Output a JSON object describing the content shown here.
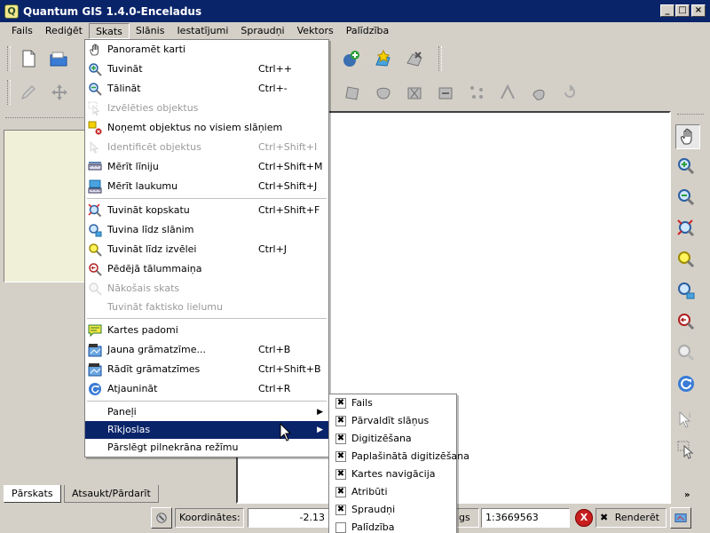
{
  "window": {
    "title": "Quantum GIS 1.4.0-Enceladus",
    "logo_letter": "Q",
    "min_glyph": "_",
    "max_glyph": "□",
    "close_glyph": "×"
  },
  "menubar": [
    "Fails",
    "Rediģēt",
    "Skats",
    "Slānis",
    "Iestatījumi",
    "Spraudņi",
    "Vektors",
    "Palīdzība"
  ],
  "view_menu": [
    {
      "label": "Panoramēt karti",
      "shortcut": "",
      "disabled": false,
      "icon": "pan-hand-icon"
    },
    {
      "label": "Tuvināt",
      "shortcut": "Ctrl++",
      "disabled": false,
      "icon": "zoom-in-icon"
    },
    {
      "label": "Tālināt",
      "shortcut": "Ctrl+-",
      "disabled": false,
      "icon": "zoom-out-icon"
    },
    {
      "label": "Izvēlēties objektus",
      "shortcut": "",
      "disabled": true,
      "icon": "select-features-icon"
    },
    {
      "label": "Noņemt objektus no visiem slāņiem",
      "shortcut": "",
      "disabled": false,
      "icon": "deselect-icon"
    },
    {
      "label": "Identificēt objektus",
      "shortcut": "Ctrl+Shift+I",
      "disabled": true,
      "icon": "identify-icon"
    },
    {
      "label": "Mērīt līniju",
      "shortcut": "Ctrl+Shift+M",
      "disabled": false,
      "icon": "measure-line-icon"
    },
    {
      "label": "Mērīt laukumu",
      "shortcut": "Ctrl+Shift+J",
      "disabled": false,
      "icon": "measure-area-icon"
    },
    {
      "sep": true
    },
    {
      "label": "Tuvināt kopskatu",
      "shortcut": "Ctrl+Shift+F",
      "disabled": false,
      "icon": "zoom-full-icon"
    },
    {
      "label": "Tuvina līdz slānim",
      "shortcut": "",
      "disabled": false,
      "icon": "zoom-layer-icon"
    },
    {
      "label": "Tuvināt līdz izvēlei",
      "shortcut": "Ctrl+J",
      "disabled": false,
      "icon": "zoom-selection-icon"
    },
    {
      "label": "Pēdējā tālummaiņa",
      "shortcut": "",
      "disabled": false,
      "icon": "zoom-last-icon"
    },
    {
      "label": "Nākošais skats",
      "shortcut": "",
      "disabled": true,
      "icon": "zoom-next-icon"
    },
    {
      "label": "Tuvināt faktisko lielumu",
      "shortcut": "",
      "disabled": true,
      "icon": ""
    },
    {
      "sep": true
    },
    {
      "label": "Kartes padomi",
      "shortcut": "",
      "disabled": false,
      "icon": "map-tips-icon"
    },
    {
      "label": "Jauna grāmatzīme...",
      "shortcut": "Ctrl+B",
      "disabled": false,
      "icon": "new-bookmark-icon"
    },
    {
      "label": "Rādīt grāmatzīmes",
      "shortcut": "Ctrl+Shift+B",
      "disabled": false,
      "icon": "show-bookmarks-icon"
    },
    {
      "label": "Atjaunināt",
      "shortcut": "Ctrl+R",
      "disabled": false,
      "icon": "refresh-icon"
    },
    {
      "sep": true
    },
    {
      "label": "Paneļi",
      "shortcut": "",
      "disabled": false,
      "submenu": true
    },
    {
      "label": "Rīkjoslas",
      "shortcut": "",
      "disabled": false,
      "submenu": true,
      "highlighted": true
    },
    {
      "label": "Pārslēgt pilnekrāna režīmu",
      "shortcut": "",
      "disabled": false
    }
  ],
  "toolbars_submenu": [
    {
      "label": "Fails",
      "checked": true
    },
    {
      "label": "Pārvaldīt slāņus",
      "checked": true
    },
    {
      "label": "Digitizēšana",
      "checked": true
    },
    {
      "label": "Paplašinātā digitizēšana",
      "checked": true
    },
    {
      "label": "Kartes navigācija",
      "checked": true
    },
    {
      "label": "Atribūti",
      "checked": true
    },
    {
      "label": "Spraudņi",
      "checked": true
    },
    {
      "label": "Palīdzība",
      "checked": false
    }
  ],
  "panel_tabs": [
    "Pārskats",
    "Atsaukt/Pārdarīt"
  ],
  "status": {
    "coords_label": "Koordinātes:",
    "coords_value": "-2.13",
    "scale_label": "gs",
    "scale_value": "1:3669563",
    "render_label": "Renderēt",
    "check_glyph": "✖",
    "stop_glyph": "X"
  },
  "expand_glyph": "»",
  "colors": {
    "titlebar": "#0a246a",
    "highlight": "#0a246a",
    "face": "#d4d0c8"
  }
}
